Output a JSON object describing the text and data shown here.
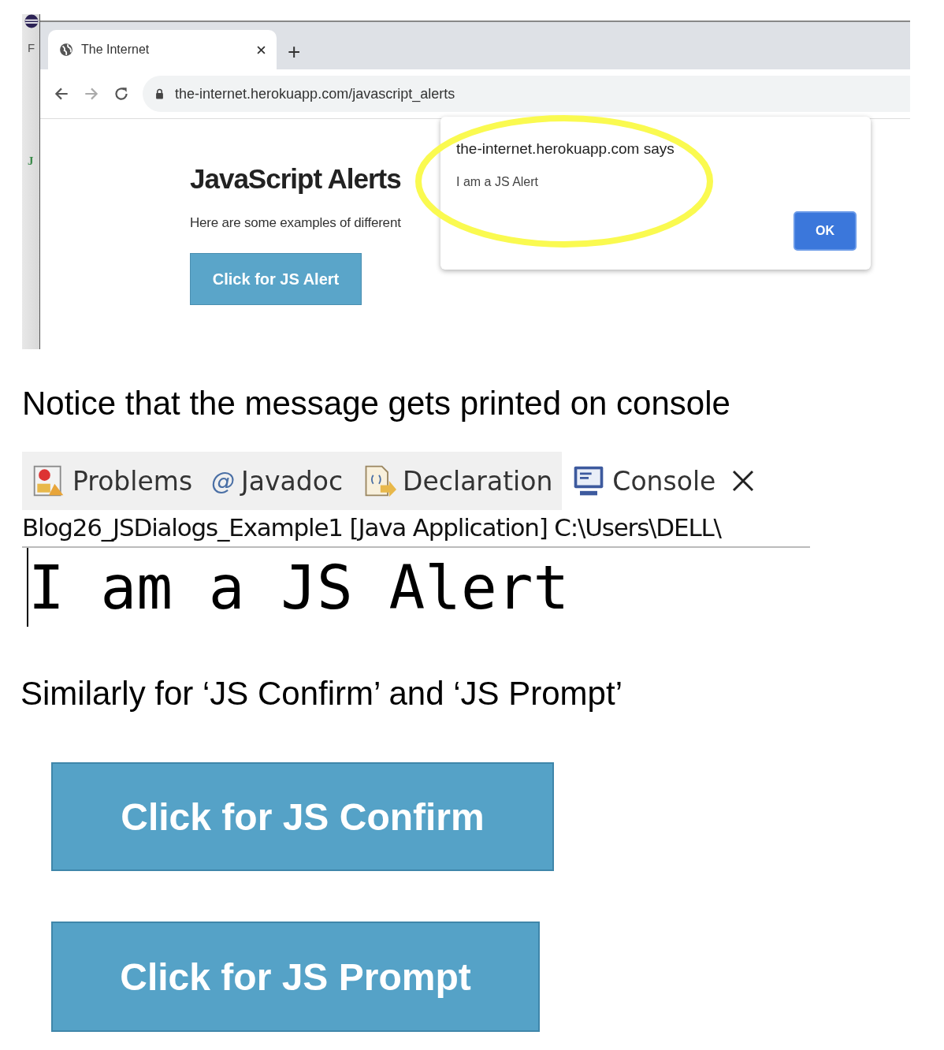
{
  "eclipse_edge": [
    "F",
    "J"
  ],
  "browser": {
    "tab": {
      "title": "The Internet",
      "selected": true
    },
    "new_tab": "+",
    "url": "the-internet.herokuapp.com/javascript_alerts"
  },
  "page": {
    "heading": "JavaScript Alerts",
    "intro": "Here are some examples of different",
    "button": "Click for JS Alert"
  },
  "alert": {
    "origin": "the-internet.herokuapp.com says",
    "message": "I am a JS Alert",
    "ok": "OK"
  },
  "caption_1": "Notice that the message gets printed on console",
  "console": {
    "tabs": [
      {
        "label": "Problems",
        "selected": false
      },
      {
        "label": "Javadoc",
        "symbol": "@",
        "selected": false
      },
      {
        "label": "Declaration",
        "selected": false
      },
      {
        "label": "Console",
        "selected": true
      }
    ],
    "launch": "Blog26_JSDialogs_Example1 [Java Application] C:\\Users\\DELL\\",
    "output": "I am a JS Alert"
  },
  "caption_2": "Similarly for ‘JS Confirm’ and ‘JS Prompt’",
  "buttons": [
    "Click for JS Confirm",
    "Click for JS Prompt"
  ]
}
